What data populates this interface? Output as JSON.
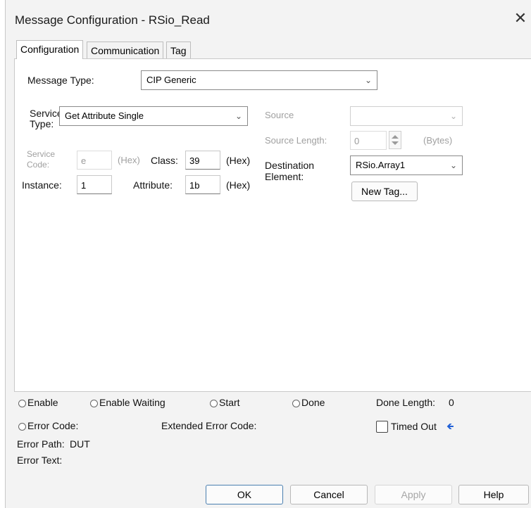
{
  "window": {
    "title": "Message Configuration - RSio_Read",
    "close_glyph": "✕"
  },
  "tabs": [
    {
      "label": "Configuration",
      "active": true
    },
    {
      "label": "Communication",
      "active": false
    },
    {
      "label": "Tag",
      "active": false
    }
  ],
  "config": {
    "message_type_label": "Message Type:",
    "message_type_value": "CIP Generic",
    "service_type_label_1": "Service",
    "service_type_label_2": "Type:",
    "service_type_value": "Get Attribute Single",
    "service_code_label_1": "Service",
    "service_code_label_2": "Code:",
    "service_code_value": "e",
    "service_code_unit": "(Hex)",
    "class_label": "Class:",
    "class_value": "39",
    "class_unit": "(Hex)",
    "instance_label": "Instance:",
    "instance_value": "1",
    "attribute_label": "Attribute:",
    "attribute_value": "1b",
    "attribute_unit": "(Hex)",
    "source_label": "Source",
    "source_value": "",
    "source_length_label": "Source Length:",
    "source_length_value": "0",
    "source_length_unit": "(Bytes)",
    "destination_label_1": "Destination",
    "destination_label_2": "Element:",
    "destination_value": "RSio.Array1",
    "new_tag_label": "New Tag..."
  },
  "status": {
    "enable": "Enable",
    "enable_waiting": "Enable Waiting",
    "start": "Start",
    "done": "Done",
    "done_length_label": "Done Length:",
    "done_length_value": "0",
    "error_code_label": "Error Code:",
    "extended_error_code_label": "Extended Error Code:",
    "timed_out_label": "Timed Out",
    "error_path_label": "Error Path:",
    "error_path_value": "DUT",
    "error_text_label": "Error Text:"
  },
  "buttons": {
    "ok": "OK",
    "cancel": "Cancel",
    "apply": "Apply",
    "help": "Help"
  },
  "icons": {
    "close": "close-icon",
    "dropdown": "chevron-down-icon",
    "timed_out_arrow": "arrow-left-icon",
    "arrow_color": "#1f5fd6"
  }
}
